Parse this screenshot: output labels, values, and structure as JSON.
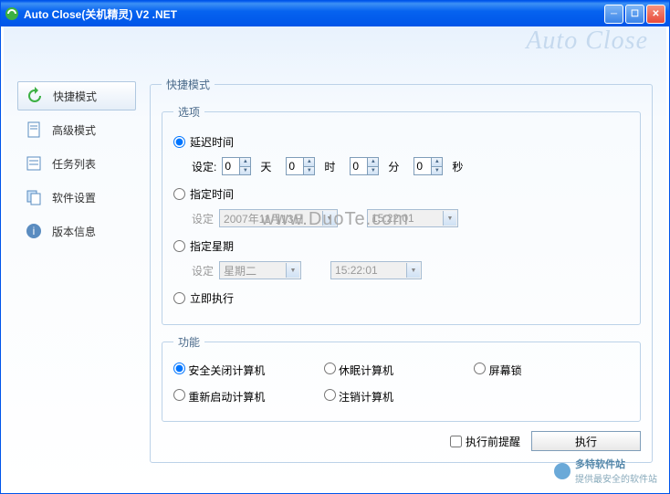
{
  "titlebar": {
    "title": "Auto Close(关机精灵) V2 .NET"
  },
  "brand": "Auto Close",
  "nav": {
    "items": [
      {
        "label": "快捷模式",
        "active": true
      },
      {
        "label": "高级模式",
        "active": false
      },
      {
        "label": "任务列表",
        "active": false
      },
      {
        "label": "软件设置",
        "active": false
      },
      {
        "label": "版本信息",
        "active": false
      }
    ]
  },
  "panel": {
    "title": "快捷模式",
    "options": {
      "legend": "选项",
      "delay": {
        "label": "延迟时间",
        "set_label": "设定:",
        "days": "0",
        "days_unit": "天",
        "hours": "0",
        "hours_unit": "时",
        "minutes": "0",
        "minutes_unit": "分",
        "seconds": "0",
        "seconds_unit": "秒"
      },
      "fixed_time": {
        "label": "指定时间",
        "set_label": "设定",
        "date": "2007年11月13日",
        "time": "15:22:01"
      },
      "fixed_week": {
        "label": "指定星期",
        "set_label": "设定",
        "week": "星期二",
        "time": "15:22:01"
      },
      "immediate": {
        "label": "立即执行"
      }
    },
    "functions": {
      "legend": "功能",
      "items": [
        "安全关闭计算机",
        "休眠计算机",
        "屏幕锁",
        "重新启动计算机",
        "注销计算机"
      ]
    },
    "footer": {
      "remind_label": "执行前提醒",
      "execute_label": "执行"
    }
  },
  "watermark": "www.DuoTe.com",
  "corner": {
    "name": "多特软件站",
    "slogan": "提供最安全的软件站"
  }
}
